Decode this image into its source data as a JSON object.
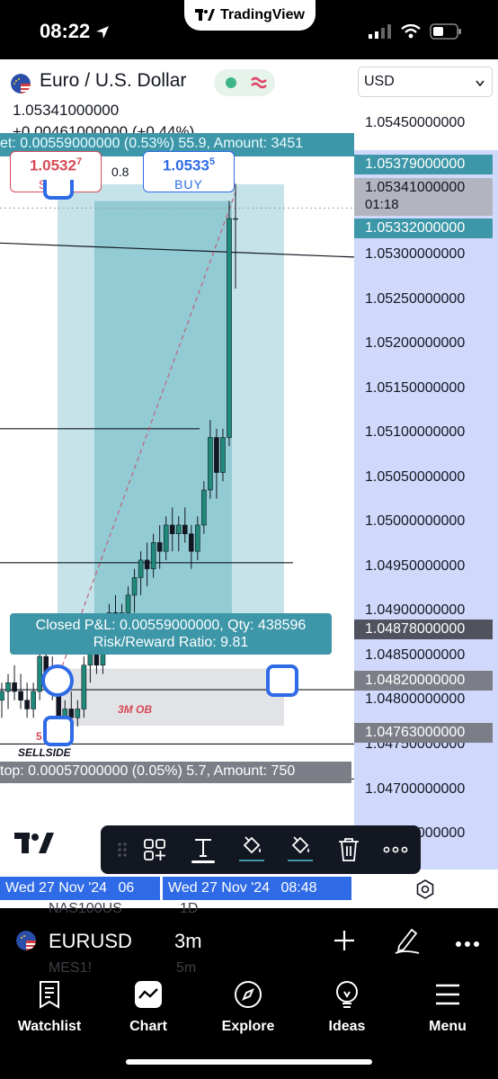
{
  "status_bar": {
    "time": "08:22",
    "app_name": "TradingView"
  },
  "header": {
    "title": "Euro / U.S. Dollar",
    "price": "1.05341000000",
    "change": "+0.00461000000 (+0.44%)",
    "currency": "USD",
    "market_status_color": "#3eb489"
  },
  "trade": {
    "sell_price_main": "1.0532",
    "sell_price_sup": "7",
    "sell_label": "SELL",
    "buy_price_main": "1.0533",
    "buy_price_sup": "5",
    "buy_label": "BUY",
    "spread": "0.8",
    "target_text": "et: 0.00559000000 (0.53%) 55.9, Amount: 3451",
    "pnl_line1": "Closed P&L: 0.00559000000, Qty: 438596",
    "pnl_line2": "Risk/Reward Ratio: 9.81",
    "stop_text": "top: 0.00057000000 (0.05%) 5.7, Amount: 750"
  },
  "annotations": {
    "ob_label": "3M OB",
    "sellside_label": "SELLSIDE",
    "small_label": "5"
  },
  "price_scale": {
    "ticks": [
      "1.05450000000",
      "1.05300000000",
      "1.05250000000",
      "1.05200000000",
      "1.05150000000",
      "1.05100000000",
      "1.05050000000",
      "1.05000000000",
      "1.04950000000",
      "1.04900000000",
      "1.04850000000",
      "1.04800000000",
      "1.04750000000",
      "1.04700000000",
      "1.04650000000"
    ],
    "labels": {
      "target": "1.05379000000",
      "last": "1.05341000000",
      "countdown": "01:18",
      "entry": "1.05332000000",
      "low": "1.04878000000",
      "stop_level": "1.04820000000",
      "bottom": "1.04763000000"
    },
    "colors": {
      "target": "#3d97a8",
      "last": "#b2b5be",
      "entry": "#3d97a8",
      "low": "#50535e",
      "stop": "#7b7e86"
    }
  },
  "time_axis": {
    "left_label": "Wed 27 Nov '24",
    "left_cut": "06",
    "right_label": "Wed 27 Nov '24",
    "right_time": "08:48"
  },
  "symbol_bar": {
    "symbol": "EURUSD",
    "interval": "3m",
    "ghost_symbol": "NAS100US",
    "ghost_interval": "1D",
    "ghost_symbol2": "MES1!",
    "ghost_interval2": "5m"
  },
  "tabs": [
    {
      "label": "Watchlist",
      "icon": "watchlist-icon"
    },
    {
      "label": "Chart",
      "icon": "chart-icon"
    },
    {
      "label": "Explore",
      "icon": "compass-icon"
    },
    {
      "label": "Ideas",
      "icon": "lightbulb-icon"
    },
    {
      "label": "Menu",
      "icon": "menu-icon"
    }
  ],
  "chart_data": {
    "type": "candlestick",
    "title": "",
    "ylim": [
      1.0464,
      1.0548
    ],
    "candles": [
      [
        1.0479,
        1.0481,
        1.0477,
        1.048
      ],
      [
        1.048,
        1.0482,
        1.0478,
        1.0481
      ],
      [
        1.0481,
        1.0483,
        1.0479,
        1.048
      ],
      [
        1.048,
        1.0482,
        1.0478,
        1.0479
      ],
      [
        1.0479,
        1.0481,
        1.0477,
        1.0478
      ],
      [
        1.0478,
        1.0481,
        1.0477,
        1.048
      ],
      [
        1.048,
        1.0485,
        1.0479,
        1.0484
      ],
      [
        1.0484,
        1.0486,
        1.0481,
        1.0482
      ],
      [
        1.0482,
        1.0484,
        1.0479,
        1.048
      ],
      [
        1.048,
        1.0481,
        1.0476,
        1.0477
      ],
      [
        1.0477,
        1.0479,
        1.0475,
        1.0478
      ],
      [
        1.0478,
        1.048,
        1.0476,
        1.0477
      ],
      [
        1.0477,
        1.0479,
        1.0476,
        1.0478
      ],
      [
        1.0478,
        1.0484,
        1.0477,
        1.0483
      ],
      [
        1.0483,
        1.0486,
        1.0481,
        1.0485
      ],
      [
        1.0485,
        1.0486,
        1.0482,
        1.0483
      ],
      [
        1.0483,
        1.0488,
        1.0482,
        1.0487
      ],
      [
        1.0487,
        1.049,
        1.0485,
        1.0489
      ],
      [
        1.0489,
        1.0491,
        1.0486,
        1.0488
      ],
      [
        1.0488,
        1.049,
        1.0486,
        1.0489
      ],
      [
        1.0489,
        1.0492,
        1.0487,
        1.0491
      ],
      [
        1.0491,
        1.0494,
        1.0489,
        1.0493
      ],
      [
        1.0493,
        1.0496,
        1.0491,
        1.0495
      ],
      [
        1.0495,
        1.0497,
        1.0492,
        1.0494
      ],
      [
        1.0494,
        1.0498,
        1.0493,
        1.0497
      ],
      [
        1.0497,
        1.0499,
        1.0494,
        1.0496
      ],
      [
        1.0496,
        1.05,
        1.0495,
        1.0499
      ],
      [
        1.0499,
        1.0501,
        1.0496,
        1.0498
      ],
      [
        1.0498,
        1.05,
        1.0496,
        1.0499
      ],
      [
        1.0499,
        1.0501,
        1.0497,
        1.0498
      ],
      [
        1.0498,
        1.0499,
        1.0494,
        1.0496
      ],
      [
        1.0496,
        1.05,
        1.0495,
        1.0499
      ],
      [
        1.0499,
        1.0504,
        1.0498,
        1.0503
      ],
      [
        1.0503,
        1.0511,
        1.0502,
        1.0509
      ],
      [
        1.0509,
        1.051,
        1.0502,
        1.0505
      ],
      [
        1.0505,
        1.051,
        1.0504,
        1.0509
      ],
      [
        1.0509,
        1.0536,
        1.0508,
        1.0534
      ],
      [
        1.0534,
        1.0538,
        1.0526,
        1.0534
      ]
    ],
    "levels": [
      1.053,
      1.051,
      1.0495,
      1.048
    ]
  }
}
